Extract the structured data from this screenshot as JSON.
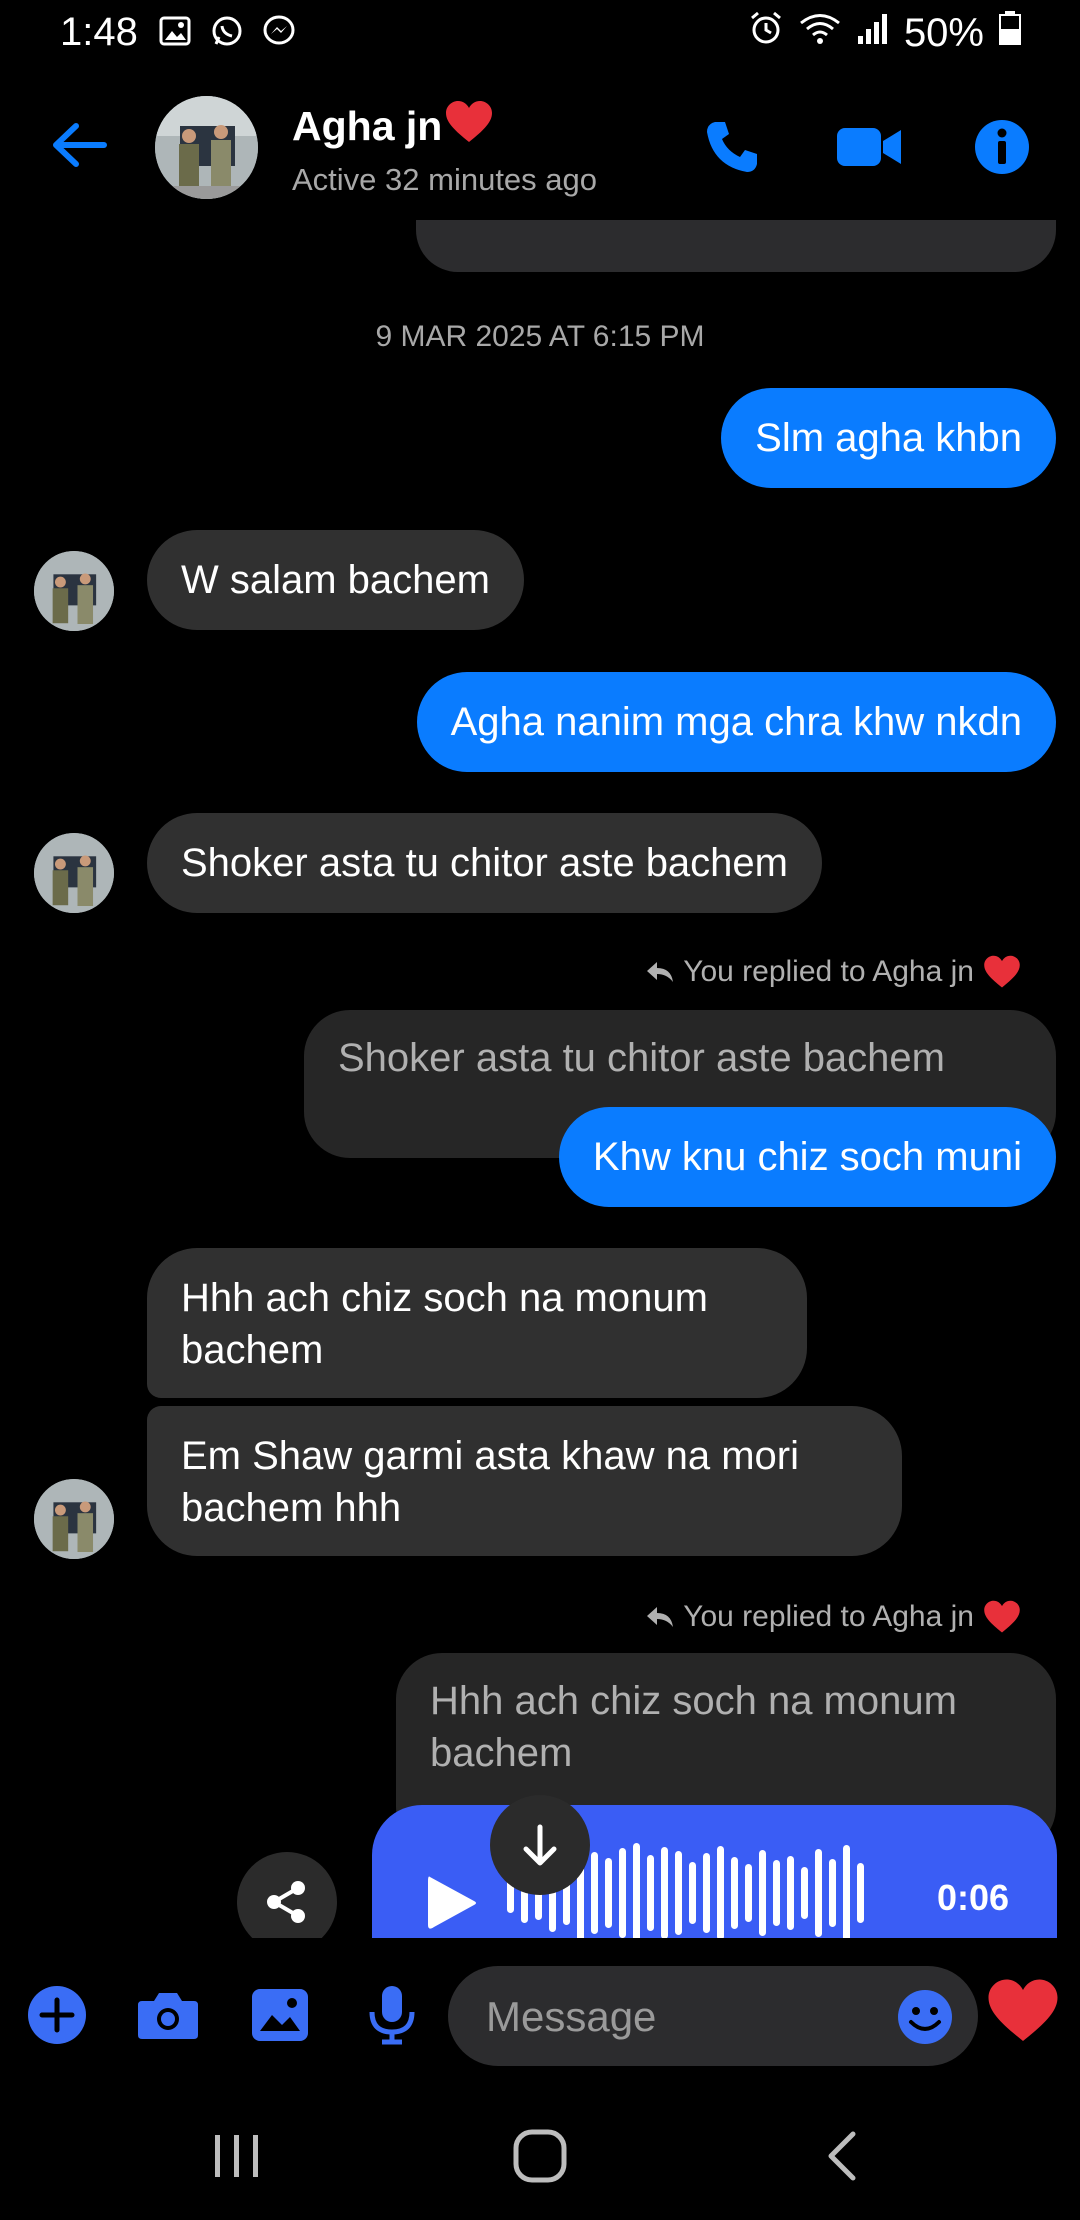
{
  "status_bar": {
    "time": "1:48",
    "battery": "50%"
  },
  "header": {
    "contact_name": "Agha jn",
    "active_status": "Active 32 minutes ago"
  },
  "chat": {
    "timestamp": "9 MAR 2025 AT 6:15 PM",
    "messages": [
      {
        "text": "Slm agha khbn"
      },
      {
        "text": "W salam  bachem"
      },
      {
        "text": "Agha nanim mga chra khw nkdn"
      },
      {
        "text": "Shoker asta tu chitor aste bachem"
      },
      {
        "text": "Shoker asta tu chitor aste bachem"
      },
      {
        "text": "Khw knu chiz soch muni"
      },
      {
        "line1": "Hhh ach chiz soch na monum",
        "line2": "bachem"
      },
      {
        "line1": "Em Shaw garmi asta khaw na mori",
        "line2": "bachem hhh"
      },
      {
        "line1": "Hhh ach chiz soch na monum",
        "line2": "bachem"
      }
    ],
    "replied_label_1": "You replied to Agha jn",
    "replied_label_2": "You replied to Agha jn",
    "audio": {
      "duration": "0:06"
    }
  },
  "composer": {
    "placeholder": "Message"
  },
  "colors": {
    "accent": "#0a7cff",
    "incoming_bubble": "#303030",
    "audio_bubble": "#3a5df5",
    "heart": "#e8303a"
  }
}
